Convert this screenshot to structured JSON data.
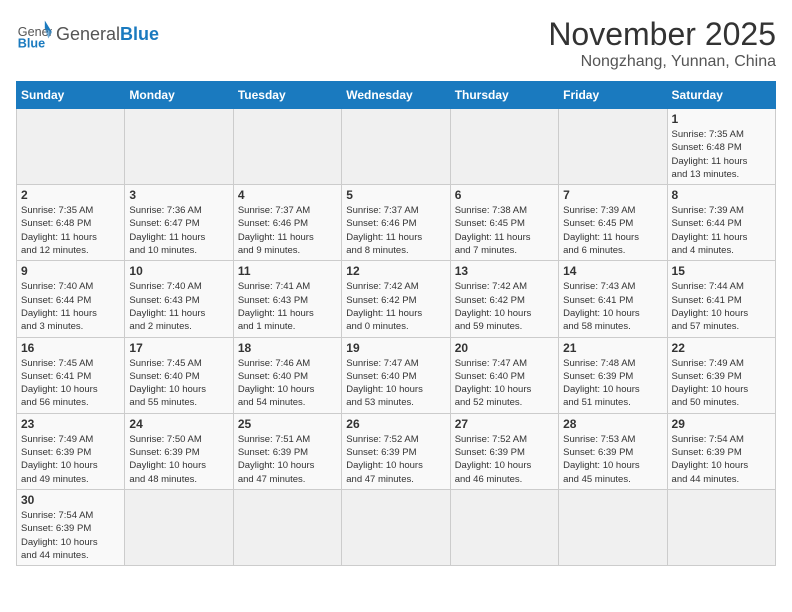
{
  "header": {
    "logo_general": "General",
    "logo_blue": "Blue",
    "month": "November 2025",
    "location": "Nongzhang, Yunnan, China"
  },
  "weekdays": [
    "Sunday",
    "Monday",
    "Tuesday",
    "Wednesday",
    "Thursday",
    "Friday",
    "Saturday"
  ],
  "days": [
    {
      "num": "",
      "info": ""
    },
    {
      "num": "",
      "info": ""
    },
    {
      "num": "",
      "info": ""
    },
    {
      "num": "",
      "info": ""
    },
    {
      "num": "",
      "info": ""
    },
    {
      "num": "",
      "info": ""
    },
    {
      "num": "1",
      "info": "Sunrise: 7:35 AM\nSunset: 6:48 PM\nDaylight: 11 hours\nand 13 minutes."
    },
    {
      "num": "2",
      "info": "Sunrise: 7:35 AM\nSunset: 6:48 PM\nDaylight: 11 hours\nand 12 minutes."
    },
    {
      "num": "3",
      "info": "Sunrise: 7:36 AM\nSunset: 6:47 PM\nDaylight: 11 hours\nand 10 minutes."
    },
    {
      "num": "4",
      "info": "Sunrise: 7:37 AM\nSunset: 6:46 PM\nDaylight: 11 hours\nand 9 minutes."
    },
    {
      "num": "5",
      "info": "Sunrise: 7:37 AM\nSunset: 6:46 PM\nDaylight: 11 hours\nand 8 minutes."
    },
    {
      "num": "6",
      "info": "Sunrise: 7:38 AM\nSunset: 6:45 PM\nDaylight: 11 hours\nand 7 minutes."
    },
    {
      "num": "7",
      "info": "Sunrise: 7:39 AM\nSunset: 6:45 PM\nDaylight: 11 hours\nand 6 minutes."
    },
    {
      "num": "8",
      "info": "Sunrise: 7:39 AM\nSunset: 6:44 PM\nDaylight: 11 hours\nand 4 minutes."
    },
    {
      "num": "9",
      "info": "Sunrise: 7:40 AM\nSunset: 6:44 PM\nDaylight: 11 hours\nand 3 minutes."
    },
    {
      "num": "10",
      "info": "Sunrise: 7:40 AM\nSunset: 6:43 PM\nDaylight: 11 hours\nand 2 minutes."
    },
    {
      "num": "11",
      "info": "Sunrise: 7:41 AM\nSunset: 6:43 PM\nDaylight: 11 hours\nand 1 minute."
    },
    {
      "num": "12",
      "info": "Sunrise: 7:42 AM\nSunset: 6:42 PM\nDaylight: 11 hours\nand 0 minutes."
    },
    {
      "num": "13",
      "info": "Sunrise: 7:42 AM\nSunset: 6:42 PM\nDaylight: 10 hours\nand 59 minutes."
    },
    {
      "num": "14",
      "info": "Sunrise: 7:43 AM\nSunset: 6:41 PM\nDaylight: 10 hours\nand 58 minutes."
    },
    {
      "num": "15",
      "info": "Sunrise: 7:44 AM\nSunset: 6:41 PM\nDaylight: 10 hours\nand 57 minutes."
    },
    {
      "num": "16",
      "info": "Sunrise: 7:45 AM\nSunset: 6:41 PM\nDaylight: 10 hours\nand 56 minutes."
    },
    {
      "num": "17",
      "info": "Sunrise: 7:45 AM\nSunset: 6:40 PM\nDaylight: 10 hours\nand 55 minutes."
    },
    {
      "num": "18",
      "info": "Sunrise: 7:46 AM\nSunset: 6:40 PM\nDaylight: 10 hours\nand 54 minutes."
    },
    {
      "num": "19",
      "info": "Sunrise: 7:47 AM\nSunset: 6:40 PM\nDaylight: 10 hours\nand 53 minutes."
    },
    {
      "num": "20",
      "info": "Sunrise: 7:47 AM\nSunset: 6:40 PM\nDaylight: 10 hours\nand 52 minutes."
    },
    {
      "num": "21",
      "info": "Sunrise: 7:48 AM\nSunset: 6:39 PM\nDaylight: 10 hours\nand 51 minutes."
    },
    {
      "num": "22",
      "info": "Sunrise: 7:49 AM\nSunset: 6:39 PM\nDaylight: 10 hours\nand 50 minutes."
    },
    {
      "num": "23",
      "info": "Sunrise: 7:49 AM\nSunset: 6:39 PM\nDaylight: 10 hours\nand 49 minutes."
    },
    {
      "num": "24",
      "info": "Sunrise: 7:50 AM\nSunset: 6:39 PM\nDaylight: 10 hours\nand 48 minutes."
    },
    {
      "num": "25",
      "info": "Sunrise: 7:51 AM\nSunset: 6:39 PM\nDaylight: 10 hours\nand 47 minutes."
    },
    {
      "num": "26",
      "info": "Sunrise: 7:52 AM\nSunset: 6:39 PM\nDaylight: 10 hours\nand 47 minutes."
    },
    {
      "num": "27",
      "info": "Sunrise: 7:52 AM\nSunset: 6:39 PM\nDaylight: 10 hours\nand 46 minutes."
    },
    {
      "num": "28",
      "info": "Sunrise: 7:53 AM\nSunset: 6:39 PM\nDaylight: 10 hours\nand 45 minutes."
    },
    {
      "num": "29",
      "info": "Sunrise: 7:54 AM\nSunset: 6:39 PM\nDaylight: 10 hours\nand 44 minutes."
    },
    {
      "num": "30",
      "info": "Sunrise: 7:54 AM\nSunset: 6:39 PM\nDaylight: 10 hours\nand 44 minutes."
    },
    {
      "num": "",
      "info": ""
    },
    {
      "num": "",
      "info": ""
    },
    {
      "num": "",
      "info": ""
    },
    {
      "num": "",
      "info": ""
    },
    {
      "num": "",
      "info": ""
    }
  ]
}
